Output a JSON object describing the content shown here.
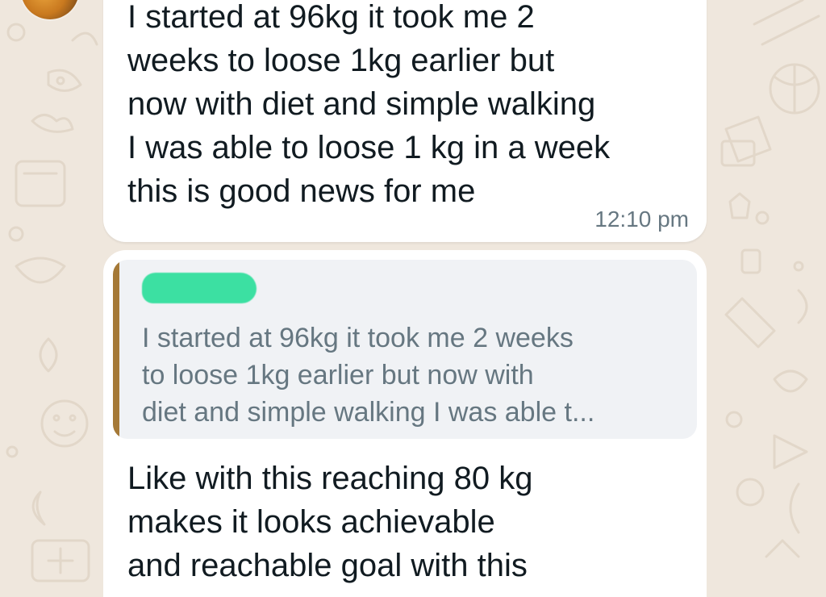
{
  "chat": {
    "messages": [
      {
        "lines": [
          "I started at 96kg it took me 2",
          "weeks to loose 1kg earlier but",
          "now with diet and simple walking",
          "I was able to loose 1 kg in a week",
          "this is good news for me"
        ],
        "time": "12:10 pm"
      },
      {
        "quoted": {
          "lines": [
            "I started at 96kg it took me 2 weeks",
            "to loose 1kg earlier but now with",
            "diet and simple walking I was able t..."
          ]
        },
        "lines": [
          "Like with this reaching 80 kg",
          "makes it looks achievable",
          "and reachable goal with this"
        ]
      }
    ]
  },
  "colors": {
    "wallpaper": "#efe7dd",
    "bubble": "#ffffff",
    "quote_bg": "#f0f2f5",
    "quote_accent": "#a57937",
    "redaction": "#3ce0a2",
    "text": "#111b21",
    "meta": "#667781"
  }
}
